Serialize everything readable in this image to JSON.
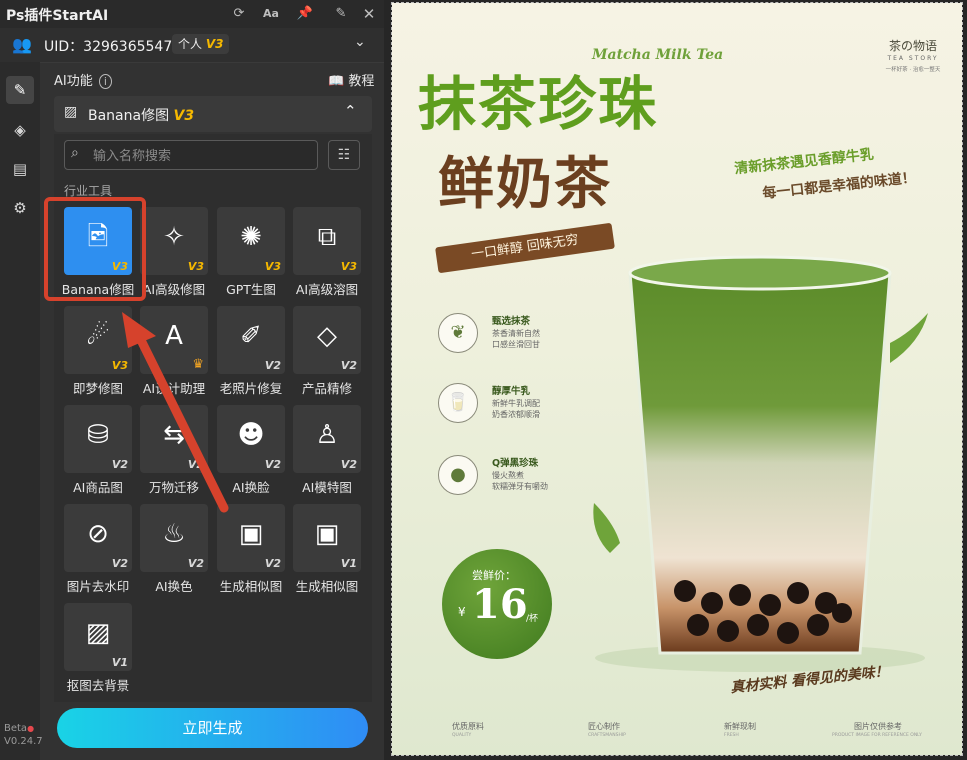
{
  "titlebar": {
    "title": "Ps插件StartAI",
    "icons": [
      "refresh-icon",
      "font-size-icon",
      "pin-icon",
      "close-icon"
    ],
    "font_label": "Aa"
  },
  "user": {
    "uid": "UID：3296365547",
    "plan": "个人",
    "plan_version": "V3"
  },
  "sidebar": {
    "items": [
      "edit-icon",
      "layers-icon",
      "clipboard-icon",
      "gear-icon"
    ]
  },
  "app": {
    "beta": "Beta",
    "version": "V0.24.7"
  },
  "ai_section": {
    "title": "AI功能",
    "tutorial": "教程"
  },
  "banana": {
    "label": "Banana修图",
    "version": "V3"
  },
  "search": {
    "placeholder": "输入名称搜索"
  },
  "tools_section": "行业工具",
  "tools": [
    {
      "name": "Banana修图",
      "ver": "V3",
      "icon": "image-edit-icon"
    },
    {
      "name": "AI高级修图",
      "ver": "V3",
      "icon": "magic-wand-icon"
    },
    {
      "name": "GPT生图",
      "ver": "V3",
      "icon": "openai-icon"
    },
    {
      "name": "AI高级溶图",
      "ver": "V3",
      "icon": "image-sparkle-icon"
    },
    {
      "name": "即梦修图",
      "ver": "V3",
      "icon": "dream-icon"
    },
    {
      "name": "AI设计助理",
      "ver": "crown",
      "icon": "ai-letter-icon"
    },
    {
      "name": "老照片修复",
      "ver": "V2",
      "icon": "photo-restore-icon"
    },
    {
      "name": "产品精修",
      "ver": "V2",
      "icon": "diamond-icon"
    },
    {
      "name": "AI商品图",
      "ver": "V2",
      "icon": "shopping-bag-icon"
    },
    {
      "name": "万物迁移",
      "ver": "V2",
      "icon": "transfer-icon"
    },
    {
      "name": "AI换脸",
      "ver": "V2",
      "icon": "face-swap-icon"
    },
    {
      "name": "AI模特图",
      "ver": "V2",
      "icon": "model-icon"
    },
    {
      "name": "图片去水印",
      "ver": "V2",
      "icon": "watermark-remove-icon"
    },
    {
      "name": "AI换色",
      "ver": "V2",
      "icon": "tshirt-color-icon"
    },
    {
      "name": "生成相似图",
      "ver": "V2",
      "icon": "similar-image-icon"
    },
    {
      "name": "生成相似图",
      "ver": "V1",
      "icon": "similar-image-alt-icon"
    },
    {
      "name": "抠图去背景",
      "ver": "V1",
      "icon": "remove-bg-icon"
    }
  ],
  "generate_button": "立即生成",
  "poster": {
    "brand": "茶の物语",
    "brand_sub": "TEA STORY",
    "brand_tag": "一杯好茶 · 治愈一整天",
    "script": "Matcha Milk Tea",
    "headline": "抹茶珍珠",
    "headline2": "鲜奶茶",
    "sub1": "清新抹茶遇见香醇牛乳",
    "sub2": "每一口都是幸福的味道！",
    "ribbon": "一口鲜醇 回味无穷",
    "features": [
      {
        "title": "甄选抹茶",
        "desc1": "茶香清新自然",
        "desc2": "口感丝滑回甘"
      },
      {
        "title": "醇厚牛乳",
        "desc1": "新鲜牛乳调配",
        "desc2": "奶香浓郁顺滑"
      },
      {
        "title": "Q弹黑珍珠",
        "desc1": "慢火熬煮",
        "desc2": "软糯弹牙有嚼劲"
      }
    ],
    "price_label": "尝鲜价：",
    "price": "16",
    "currency": "¥",
    "unit": "/杯",
    "slogan": "真材实料 看得见的美味！",
    "footer": [
      {
        "t": "优质原料",
        "s": "QUALITY"
      },
      {
        "t": "匠心制作",
        "s": "CRAFTSMANSHIP"
      },
      {
        "t": "新鲜现制",
        "s": "FRESH"
      },
      {
        "t": "图片仅供参考",
        "s": "PRODUCT IMAGE FOR REFERENCE ONLY"
      }
    ]
  },
  "colors": {
    "accent": "#2e8ff0",
    "version_gold": "#f5b800",
    "annotation_red": "#d6422c",
    "button_gradient_start": "#19d3e6",
    "button_gradient_end": "#2f8cf5"
  }
}
